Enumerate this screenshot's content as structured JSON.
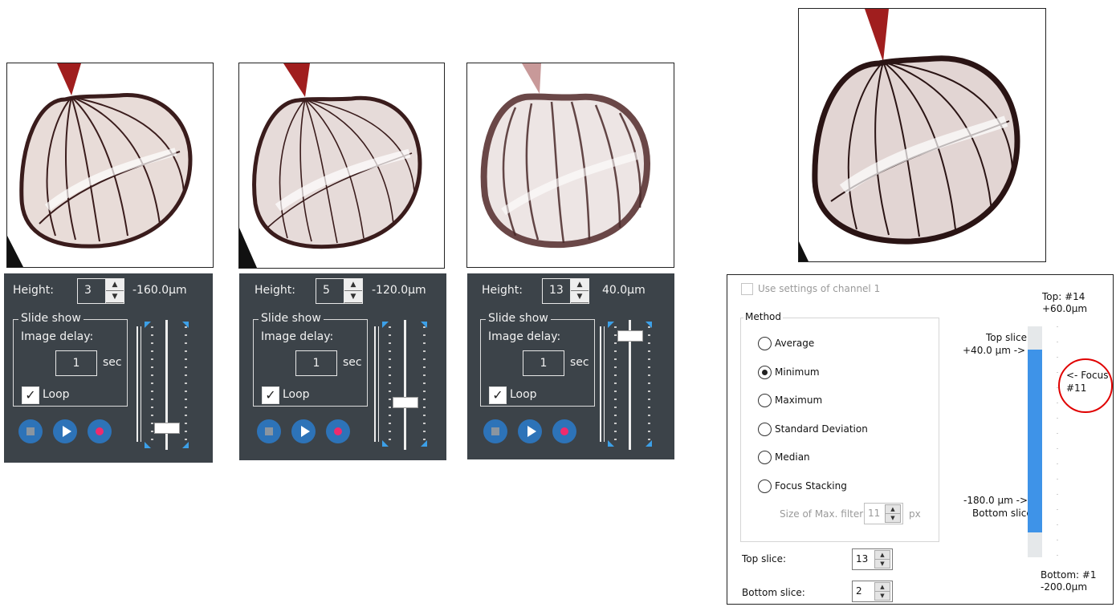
{
  "panels": [
    {
      "height_label": "Height:",
      "height_value": "3",
      "height_text": "-160.0µm",
      "slideshow_legend": "Slide show",
      "image_delay_label": "Image delay:",
      "delay_value": "1",
      "sec_label": "sec",
      "loop_label": "Loop",
      "loop_checked": true,
      "slider_level": 0.14
    },
    {
      "height_label": "Height:",
      "height_value": "5",
      "height_text": "-120.0µm",
      "slideshow_legend": "Slide show",
      "image_delay_label": "Image delay:",
      "delay_value": "1",
      "sec_label": "sec",
      "loop_label": "Loop",
      "loop_checked": true,
      "slider_level": 0.36
    },
    {
      "height_label": "Height:",
      "height_value": "13",
      "height_text": "40.0µm",
      "slideshow_legend": "Slide show",
      "image_delay_label": "Image delay:",
      "delay_value": "1",
      "sec_label": "sec",
      "loop_label": "Loop",
      "loop_checked": true,
      "slider_level": 0.94
    }
  ],
  "projection": {
    "use_settings_label": "Use settings of channel 1",
    "method_legend": "Method",
    "methods": [
      "Average",
      "Minimum",
      "Maximum",
      "Standard Deviation",
      "Median",
      "Focus Stacking"
    ],
    "selected_method": "Minimum",
    "max_filter_label": "Size of Max. filter:",
    "max_filter_value": "11",
    "max_filter_unit": "px",
    "top_slice_label": "Top slice:",
    "top_slice_value": "13",
    "bottom_slice_label": "Bottom slice:",
    "bottom_slice_value": "2",
    "top_heading": "Top: #14",
    "top_um": "+60.0µm",
    "top_slice_marker_1": "Top slice",
    "top_slice_marker_2": "+40.0 µm ->",
    "focus_line_1": "<- Focus",
    "focus_line_2": "#11",
    "bottom_marker_1": "-180.0 µm ->",
    "bottom_marker_2": "Bottom slice",
    "bottom_heading": "Bottom: #1",
    "bottom_um": "-200.0µm"
  },
  "colors": {
    "panel_bg": "#3c4349",
    "accent_blue": "#3e93e8",
    "record_pink": "#ef2b6d",
    "focus_circle": "#e00000"
  }
}
